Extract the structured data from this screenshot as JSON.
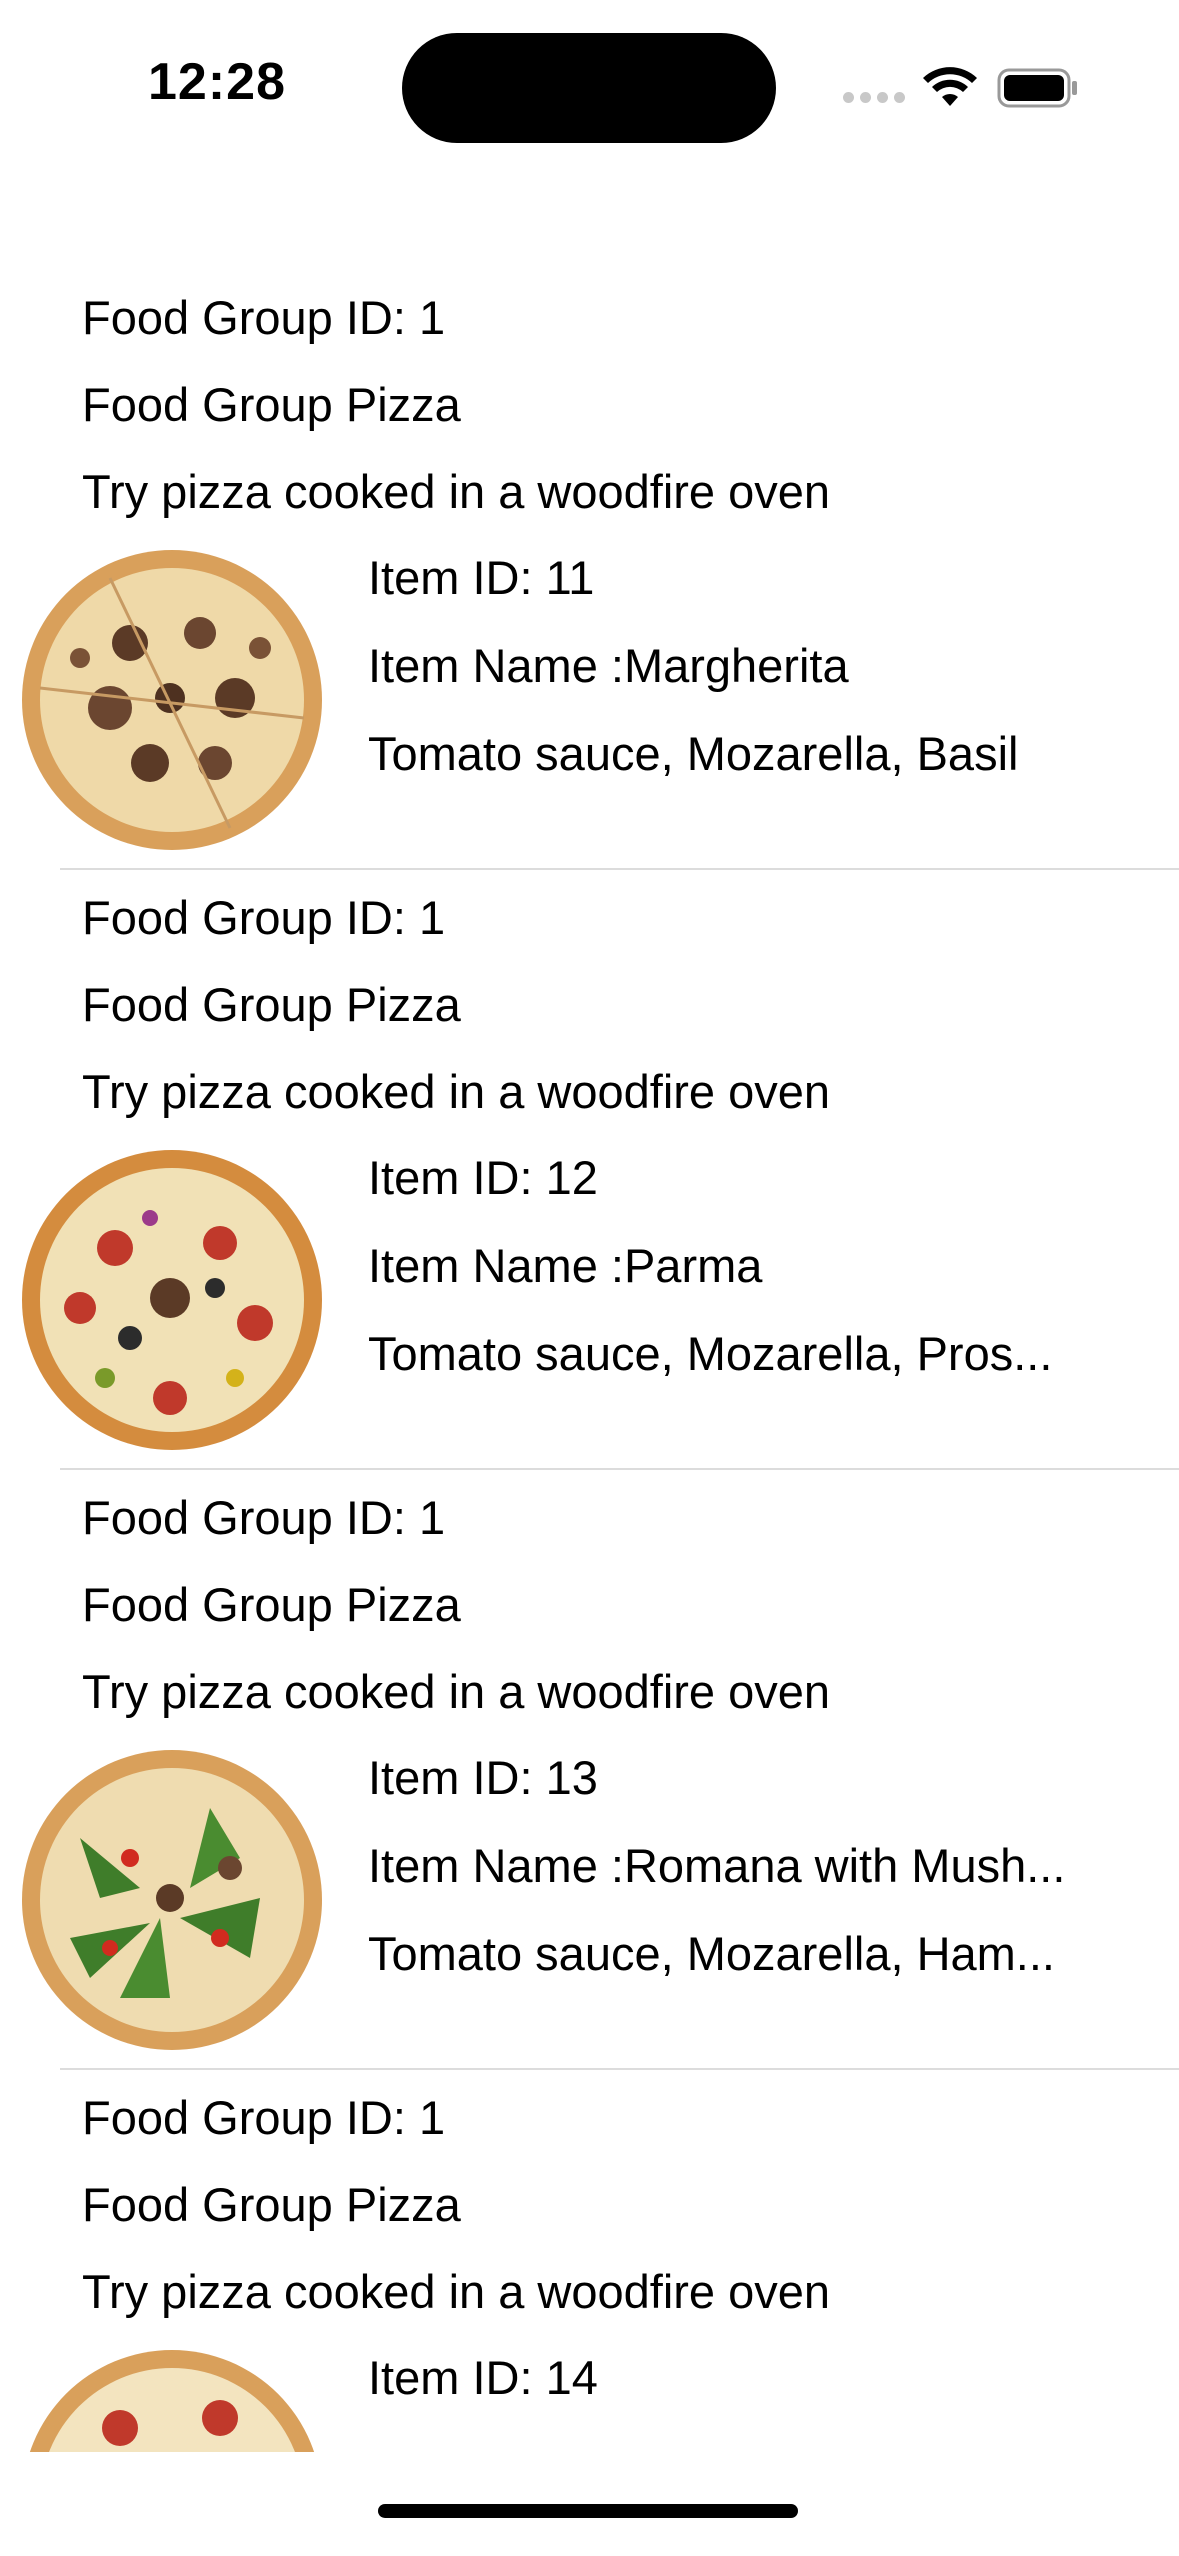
{
  "status_bar": {
    "time": "12:28",
    "icons": [
      "cellular-signal-icon",
      "wifi-icon",
      "battery-icon"
    ]
  },
  "items": [
    {
      "group_id_text": "Food Group ID: 1",
      "group_name_text": "Food Group Pizza",
      "group_desc_text": "Try pizza cooked in a woodfire oven",
      "item_id_text": "Item ID: 11",
      "item_name_text": "Item Name :Margherita",
      "item_desc_text": "Tomato sauce, Mozarella, Basil",
      "image": "pizza-photo"
    },
    {
      "group_id_text": "Food Group ID: 1",
      "group_name_text": "Food Group Pizza",
      "group_desc_text": "Try pizza cooked in a woodfire oven",
      "item_id_text": "Item ID: 12",
      "item_name_text": "Item Name :Parma",
      "item_desc_text": "Tomato sauce, Mozarella, Pros...",
      "image": "pizza-photo"
    },
    {
      "group_id_text": "Food Group ID: 1",
      "group_name_text": "Food Group Pizza",
      "group_desc_text": "Try pizza cooked in a woodfire oven",
      "item_id_text": "Item ID: 13",
      "item_name_text": "Item Name :Romana with Mush...",
      "item_desc_text": "Tomato sauce, Mozarella, Ham...",
      "image": "pizza-photo"
    },
    {
      "group_id_text": "Food Group ID: 1",
      "group_name_text": "Food Group Pizza",
      "group_desc_text": "Try pizza cooked in a woodfire oven",
      "item_id_text": "Item ID: 14",
      "item_name_text": "",
      "item_desc_text": "",
      "image": "pizza-photo"
    }
  ],
  "colors": {
    "background": "#ffffff",
    "text": "#000000",
    "separator": "#dcdcdc",
    "crust": "#d9a05b",
    "cheese": "#f3e2b8"
  }
}
